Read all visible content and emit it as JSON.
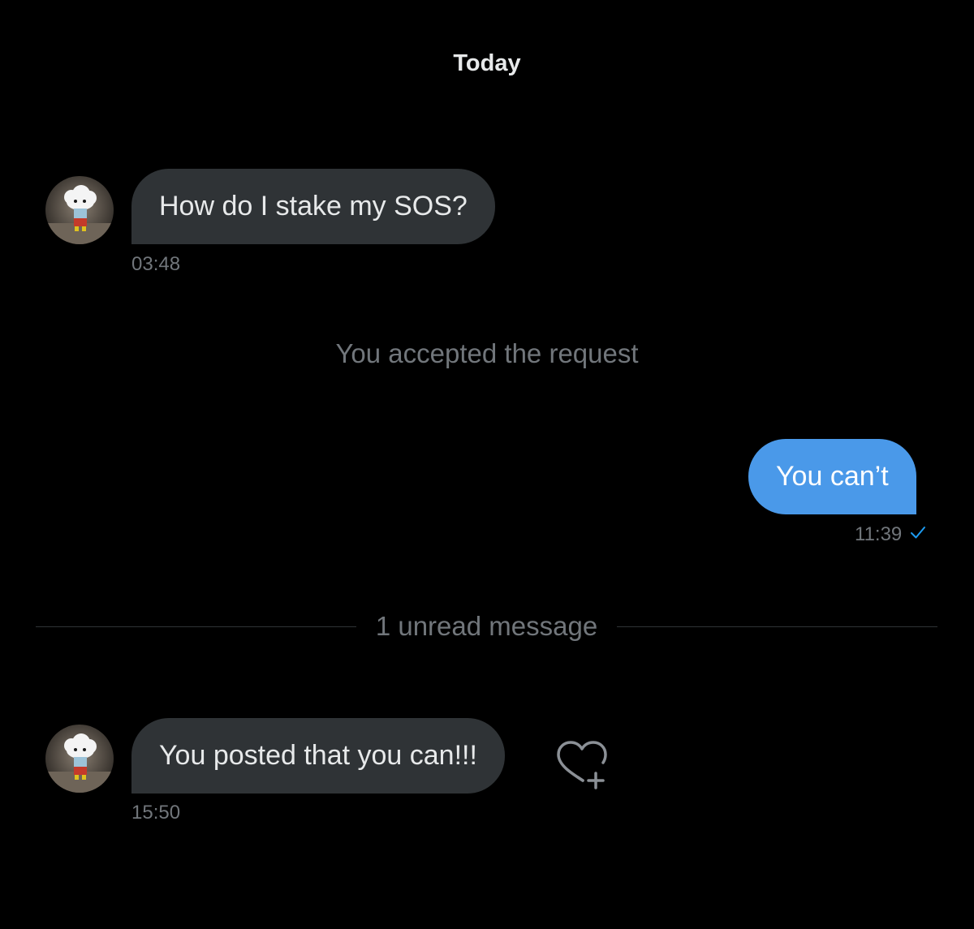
{
  "conversation": {
    "day_label": "Today",
    "messages": [
      {
        "direction": "incoming",
        "text": "How do I stake my SOS?",
        "time": "03:48"
      },
      {
        "direction": "outgoing",
        "text": "You can’t",
        "time": "11:39",
        "status_icon": "check-icon",
        "status": "sent"
      },
      {
        "direction": "incoming",
        "text": "You posted that you can!!!",
        "time": "15:50",
        "reaction_icon": "heart-plus-icon"
      }
    ],
    "system_note": "You accepted the request",
    "unread_divider": "1 unread message"
  },
  "colors": {
    "background": "#000000",
    "incoming_bubble": "#2f3336",
    "outgoing_bubble": "#4a99e9",
    "muted_text": "#71767b",
    "accent": "#1d9bf0"
  }
}
